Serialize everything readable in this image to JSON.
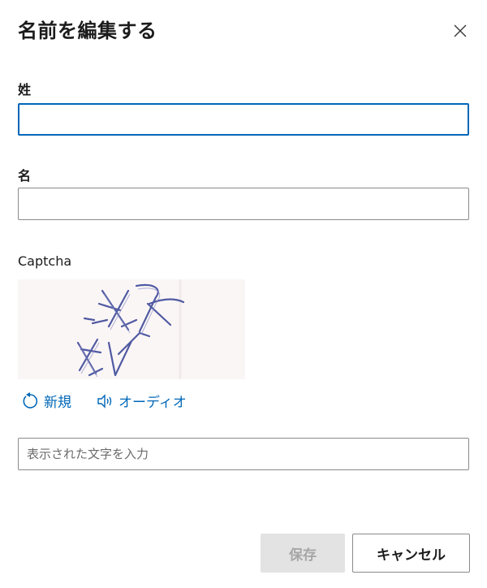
{
  "dialog": {
    "title": "名前を編集する",
    "close_icon": "close-icon"
  },
  "fields": {
    "last_name_label": "姓",
    "last_name_value": "",
    "first_name_label": "名",
    "first_name_value": ""
  },
  "captcha": {
    "label": "Captcha",
    "refresh_label": "新規",
    "refresh_icon": "refresh-icon",
    "audio_label": "オーディオ",
    "audio_icon": "speaker-icon",
    "input_placeholder": "表示された文字を入力"
  },
  "buttons": {
    "save_label": "保存",
    "cancel_label": "キャンセル"
  },
  "colors": {
    "accent": "#0067b8",
    "text": "#1b1b1b",
    "border": "#8a8a8a",
    "disabled_bg": "#e3e3e3",
    "disabled_text": "#a6a6a6",
    "captcha_ink": "#3e4a9a"
  }
}
